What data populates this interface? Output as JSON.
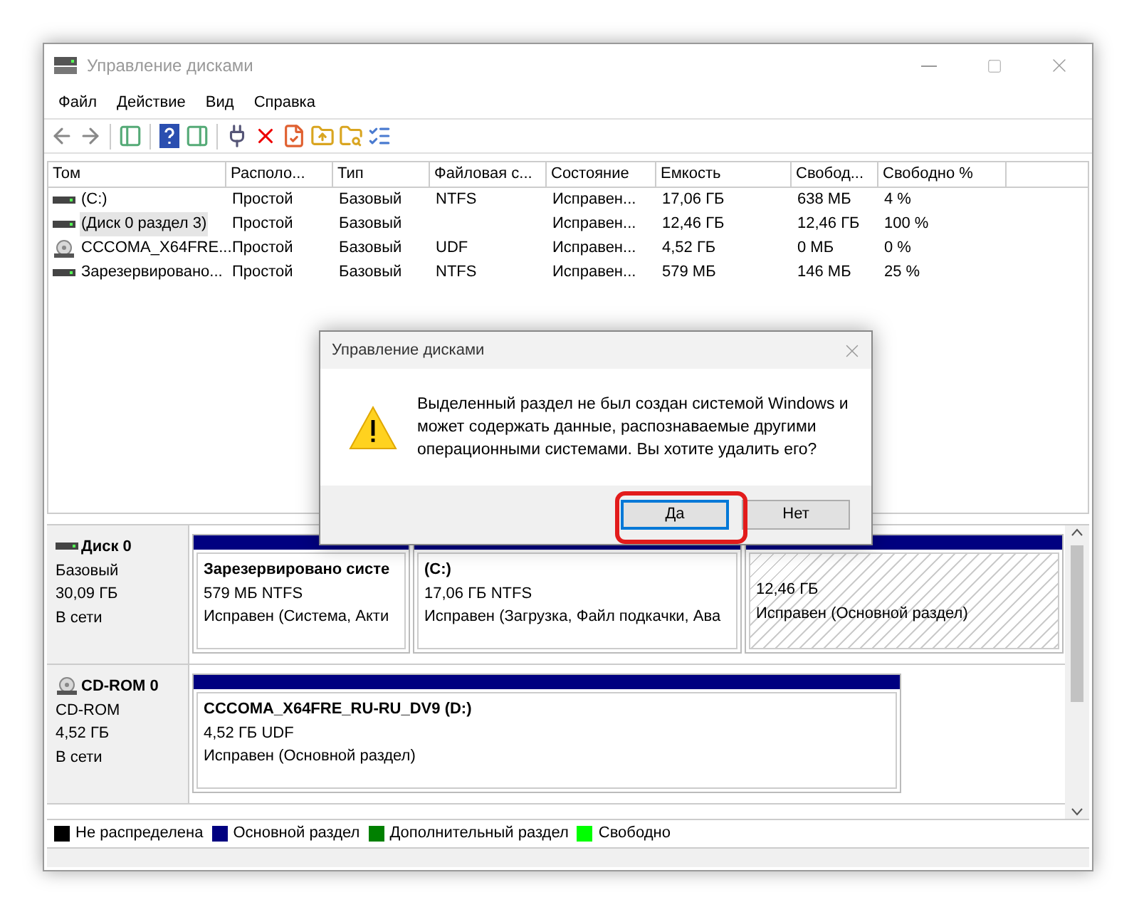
{
  "window": {
    "title": "Управление дисками"
  },
  "menu": [
    "Файл",
    "Действие",
    "Вид",
    "Справка"
  ],
  "volumes": {
    "columns": [
      "Том",
      "Располо...",
      "Тип",
      "Файловая с...",
      "Состояние",
      "Емкость",
      "Свобод...",
      "Свободно %"
    ],
    "rows": [
      {
        "kind": "disk",
        "selected": false,
        "cells": [
          "(C:)",
          "Простой",
          "Базовый",
          "NTFS",
          "Исправен...",
          "17,06 ГБ",
          "638 МБ",
          "4 %"
        ]
      },
      {
        "kind": "disk",
        "selected": true,
        "cells": [
          "(Диск 0 раздел 3)",
          "Простой",
          "Базовый",
          "",
          "Исправен...",
          "12,46 ГБ",
          "12,46 ГБ",
          "100 %"
        ]
      },
      {
        "kind": "cd",
        "selected": false,
        "cells": [
          "CCCOMA_X64FRE...",
          "Простой",
          "Базовый",
          "UDF",
          "Исправен...",
          "4,52 ГБ",
          "0 МБ",
          "0 %"
        ]
      },
      {
        "kind": "disk",
        "selected": false,
        "cells": [
          "Зарезервировано...",
          "Простой",
          "Базовый",
          "NTFS",
          "Исправен...",
          "579 МБ",
          "146 МБ",
          "25 %"
        ]
      }
    ]
  },
  "disks": [
    {
      "kind": "disk",
      "name": "Диск 0",
      "type": "Базовый",
      "size": "30,09 ГБ",
      "status": "В сети",
      "partitions": [
        {
          "name": "Зарезервировано систе",
          "size": "579 МБ NTFS",
          "status": "Исправен (Система, Акти",
          "selected": false
        },
        {
          "name": "(C:)",
          "size": "17,06 ГБ NTFS",
          "status": "Исправен (Загрузка, Файл подкачки, Ава",
          "selected": false
        },
        {
          "size": "12,46 ГБ",
          "status": "Исправен (Основной раздел)",
          "selected": true
        }
      ]
    },
    {
      "kind": "cd",
      "name": "CD-ROM 0",
      "type": "CD-ROM",
      "size": "4,52 ГБ",
      "status": "В сети",
      "partitions": [
        {
          "name": "CCCOMA_X64FRE_RU-RU_DV9  (D:)",
          "size": "4,52 ГБ UDF",
          "status": "Исправен (Основной раздел)",
          "selected": false
        }
      ]
    }
  ],
  "legend": [
    {
      "label": "Не распределена",
      "color": "#000000"
    },
    {
      "label": "Основной раздел",
      "color": "#000080"
    },
    {
      "label": "Дополнительный раздел",
      "color": "#008000"
    },
    {
      "label": "Свободно",
      "color": "#00ff00"
    }
  ],
  "dialog": {
    "title": "Управление дисками",
    "message": "Выделенный раздел не был создан системой Windows и может содержать данные, распознаваемые другими операционными системами. Вы хотите удалить его?",
    "buttons": [
      {
        "label": "Да",
        "default": true
      },
      {
        "label": "Нет",
        "default": false
      }
    ]
  }
}
